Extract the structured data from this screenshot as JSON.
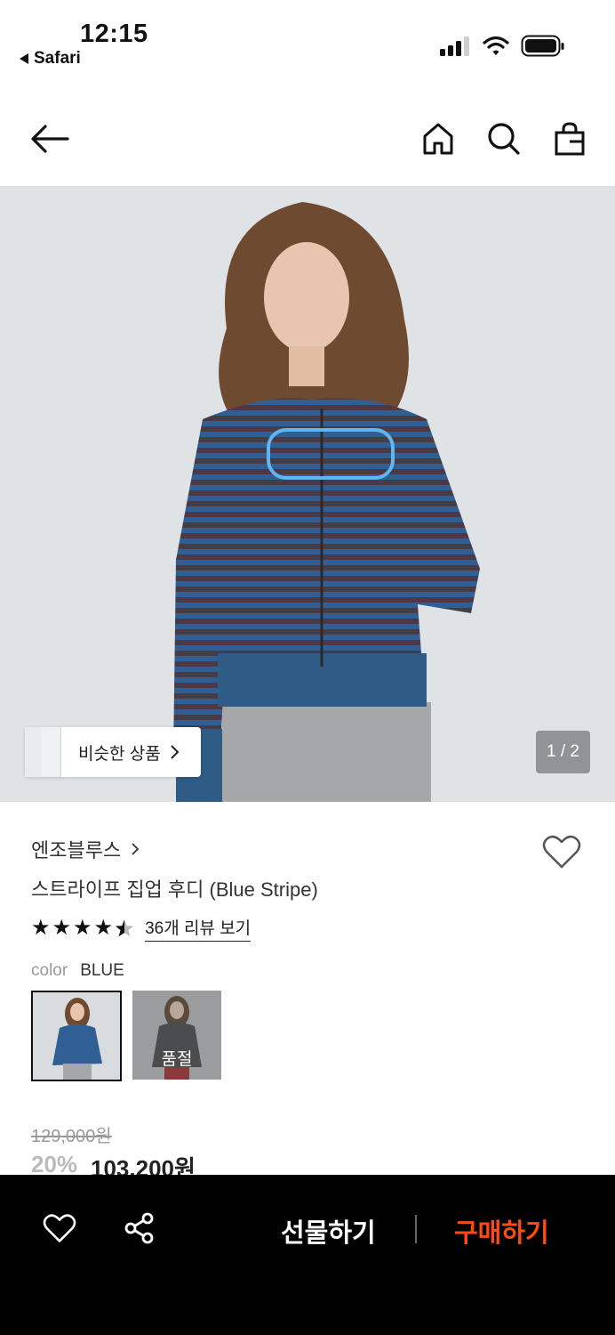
{
  "status": {
    "time": "12:15",
    "back_app": "Safari"
  },
  "header": {
    "back_icon": "arrow-left-icon",
    "icons": [
      "home-icon",
      "search-icon",
      "shopping-bag-icon"
    ]
  },
  "image": {
    "counter": "1 / 2",
    "similar_label": "비슷한 상품"
  },
  "product": {
    "brand": "엔조블루스",
    "title": "스트라이프 집업 후디 (Blue Stripe)",
    "rating": 4.5,
    "review_link": "36개 리뷰 보기",
    "color_key": "color",
    "color_value": "BLUE",
    "sold_out": "품절",
    "original_price": "129,000원",
    "discount": "20%",
    "price": "103,200원"
  },
  "bottom": {
    "gift": "선물하기",
    "buy": "구매하기",
    "accent": "#ff4b12"
  }
}
